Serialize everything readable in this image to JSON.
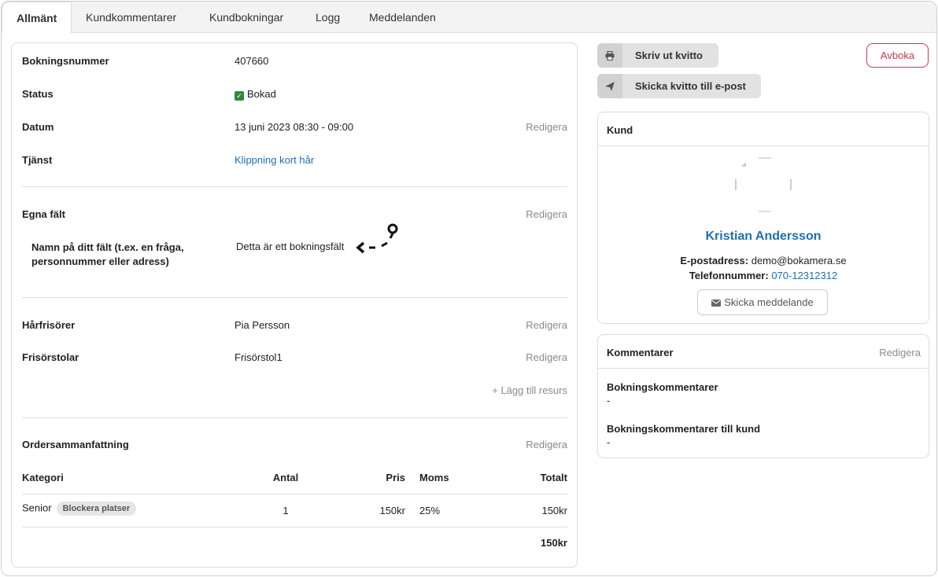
{
  "tabs": [
    {
      "label": "Allmänt",
      "active": true
    },
    {
      "label": "Kundkommentarer"
    },
    {
      "label": "Kundbokningar"
    },
    {
      "label": "Logg"
    },
    {
      "label": "Meddelanden"
    }
  ],
  "booking": {
    "number_label": "Bokningsnummer",
    "number_value": "407660",
    "status_label": "Status",
    "status_value": "Bokad",
    "date_label": "Datum",
    "date_value": "13 juni 2023 08:30 - 09:00",
    "service_label": "Tjänst",
    "service_value": "Klippning kort hår",
    "edit_label": "Redigera"
  },
  "custom_fields": {
    "section_label": "Egna fält",
    "field_name": "Namn på ditt fält (t.ex. en fråga, personnummer eller adress)",
    "field_value": "Detta är ett bokningsfält"
  },
  "resources": {
    "items": [
      {
        "label": "Hårfrisörer",
        "value": "Pia Persson"
      },
      {
        "label": "Frisörstolar",
        "value": "Frisörstol1"
      }
    ],
    "add_label": "+ Lägg till resurs"
  },
  "order": {
    "title": "Ordersammanfattning",
    "headers": {
      "category": "Kategori",
      "qty": "Antal",
      "price": "Pris",
      "vat": "Moms",
      "total": "Totalt"
    },
    "row": {
      "category": "Senior",
      "badge": "Blockera platser",
      "qty": "1",
      "price": "150kr",
      "vat": "25%",
      "total": "150kr"
    },
    "grand_total": "150kr"
  },
  "actions": {
    "print_label": "Skriv ut kvitto",
    "email_label": "Skicka kvitto till e-post",
    "cancel_label": "Avboka"
  },
  "customer": {
    "title": "Kund",
    "name": "Kristian Andersson",
    "email_label": "E-postadress:",
    "email_value": "demo@bokamera.se",
    "phone_label": "Telefonnummer:",
    "phone_value": "070-12312312",
    "message_button": "Skicka meddelande"
  },
  "comments": {
    "title": "Kommentarer",
    "edit_label": "Redigera",
    "booking_comments_label": "Bokningskommentarer",
    "booking_comments_value": "-",
    "customer_comments_label": "Bokningskommentarer till kund",
    "customer_comments_value": "-"
  },
  "colors": {
    "link": "#1f6fb2",
    "cancel": "#c23b53",
    "status_green": "#2e8b3a"
  }
}
